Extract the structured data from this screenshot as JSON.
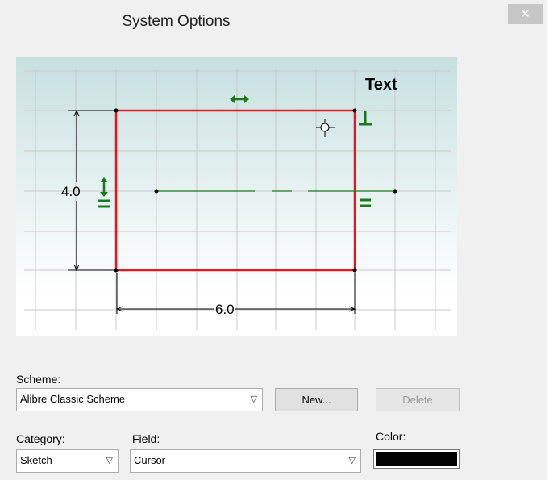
{
  "window": {
    "title": "System Options",
    "close_glyph": "✕"
  },
  "preview": {
    "sample_text": "Text",
    "height_dimension": "4.0",
    "width_dimension": "6.0"
  },
  "scheme": {
    "label": "Scheme:",
    "value": "Alibre Classic Scheme",
    "new_button": "New...",
    "delete_button": "Delete"
  },
  "category": {
    "label": "Category:",
    "value": "Sketch"
  },
  "field": {
    "label": "Field:",
    "value": "Cursor"
  },
  "color": {
    "label": "Color:",
    "value": "#000000"
  },
  "colors": {
    "sketch_lines": "#e8161c",
    "constraints": "#1a7a1a",
    "grid": "#c8c8c8"
  }
}
